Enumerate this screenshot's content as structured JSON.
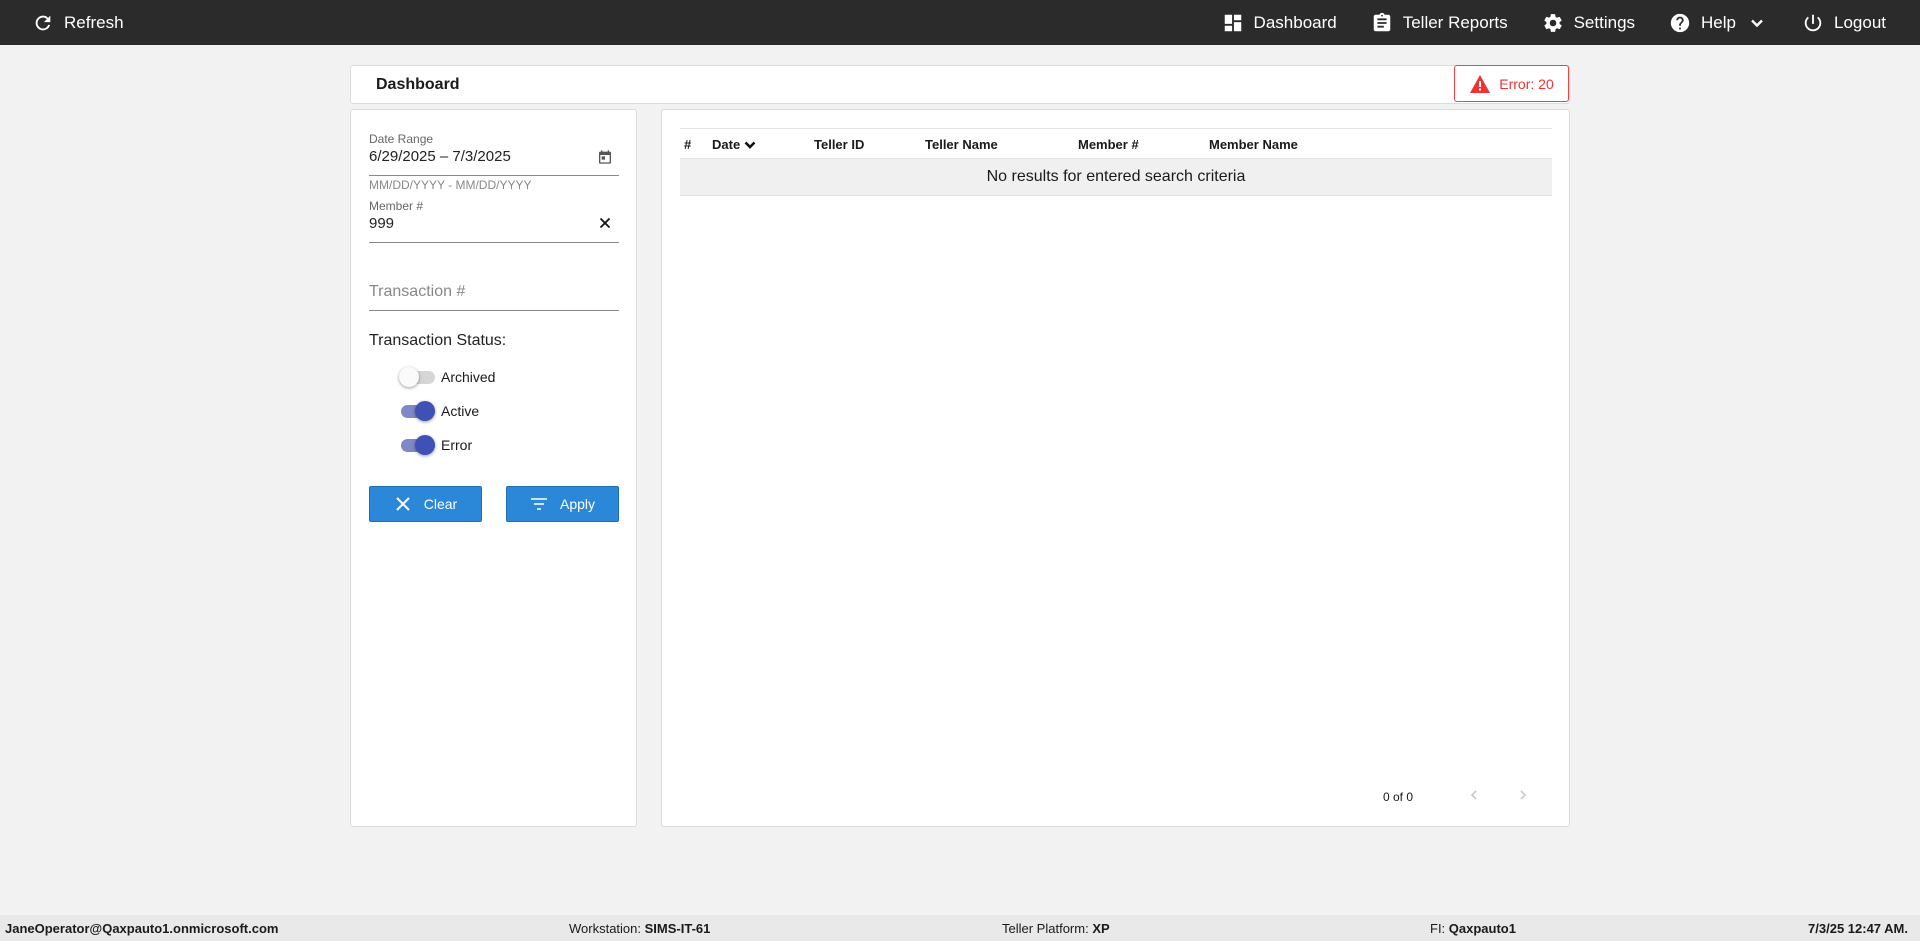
{
  "topbar": {
    "refresh_label": "Refresh",
    "nav": [
      {
        "label": "Dashboard",
        "icon": "dashboard-icon"
      },
      {
        "label": "Teller Reports",
        "icon": "clipboard-icon"
      },
      {
        "label": "Settings",
        "icon": "gear-icon"
      },
      {
        "label": "Help",
        "icon": "help-icon"
      },
      {
        "label": "Logout",
        "icon": "power-icon"
      }
    ]
  },
  "header": {
    "title": "Dashboard",
    "error_badge": "Error: 20"
  },
  "filters": {
    "date_range": {
      "label": "Date Range",
      "value": "6/29/2025 – 7/3/2025",
      "hint": "MM/DD/YYYY - MM/DD/YYYY"
    },
    "member": {
      "label": "Member #",
      "value": "999"
    },
    "transaction": {
      "placeholder": "Transaction #"
    },
    "status_title": "Transaction Status:",
    "statuses": [
      {
        "label": "Archived",
        "on": false
      },
      {
        "label": "Active",
        "on": true
      },
      {
        "label": "Error",
        "on": true
      }
    ],
    "clear_label": "Clear",
    "apply_label": "Apply"
  },
  "table": {
    "columns": [
      "#",
      "Date",
      "Teller ID",
      "Teller Name",
      "Member #",
      "Member Name"
    ],
    "empty_message": "No results for entered search criteria",
    "pager_text": "0 of 0"
  },
  "footer": {
    "user": "JaneOperator@Qaxpauto1.onmicrosoft.com",
    "workstation_label": "Workstation:",
    "workstation_value": "SIMS-IT-61",
    "platform_label": "Teller Platform:",
    "platform_value": "XP",
    "fi_label": "FI:",
    "fi_value": "Qaxpauto1",
    "datetime": "7/3/25 12:47 AM."
  },
  "colors": {
    "topbar_bg": "#2b2b2b",
    "accent_button": "#2b88d8",
    "toggle_on": "#3f51b5",
    "error": "#e33333"
  }
}
